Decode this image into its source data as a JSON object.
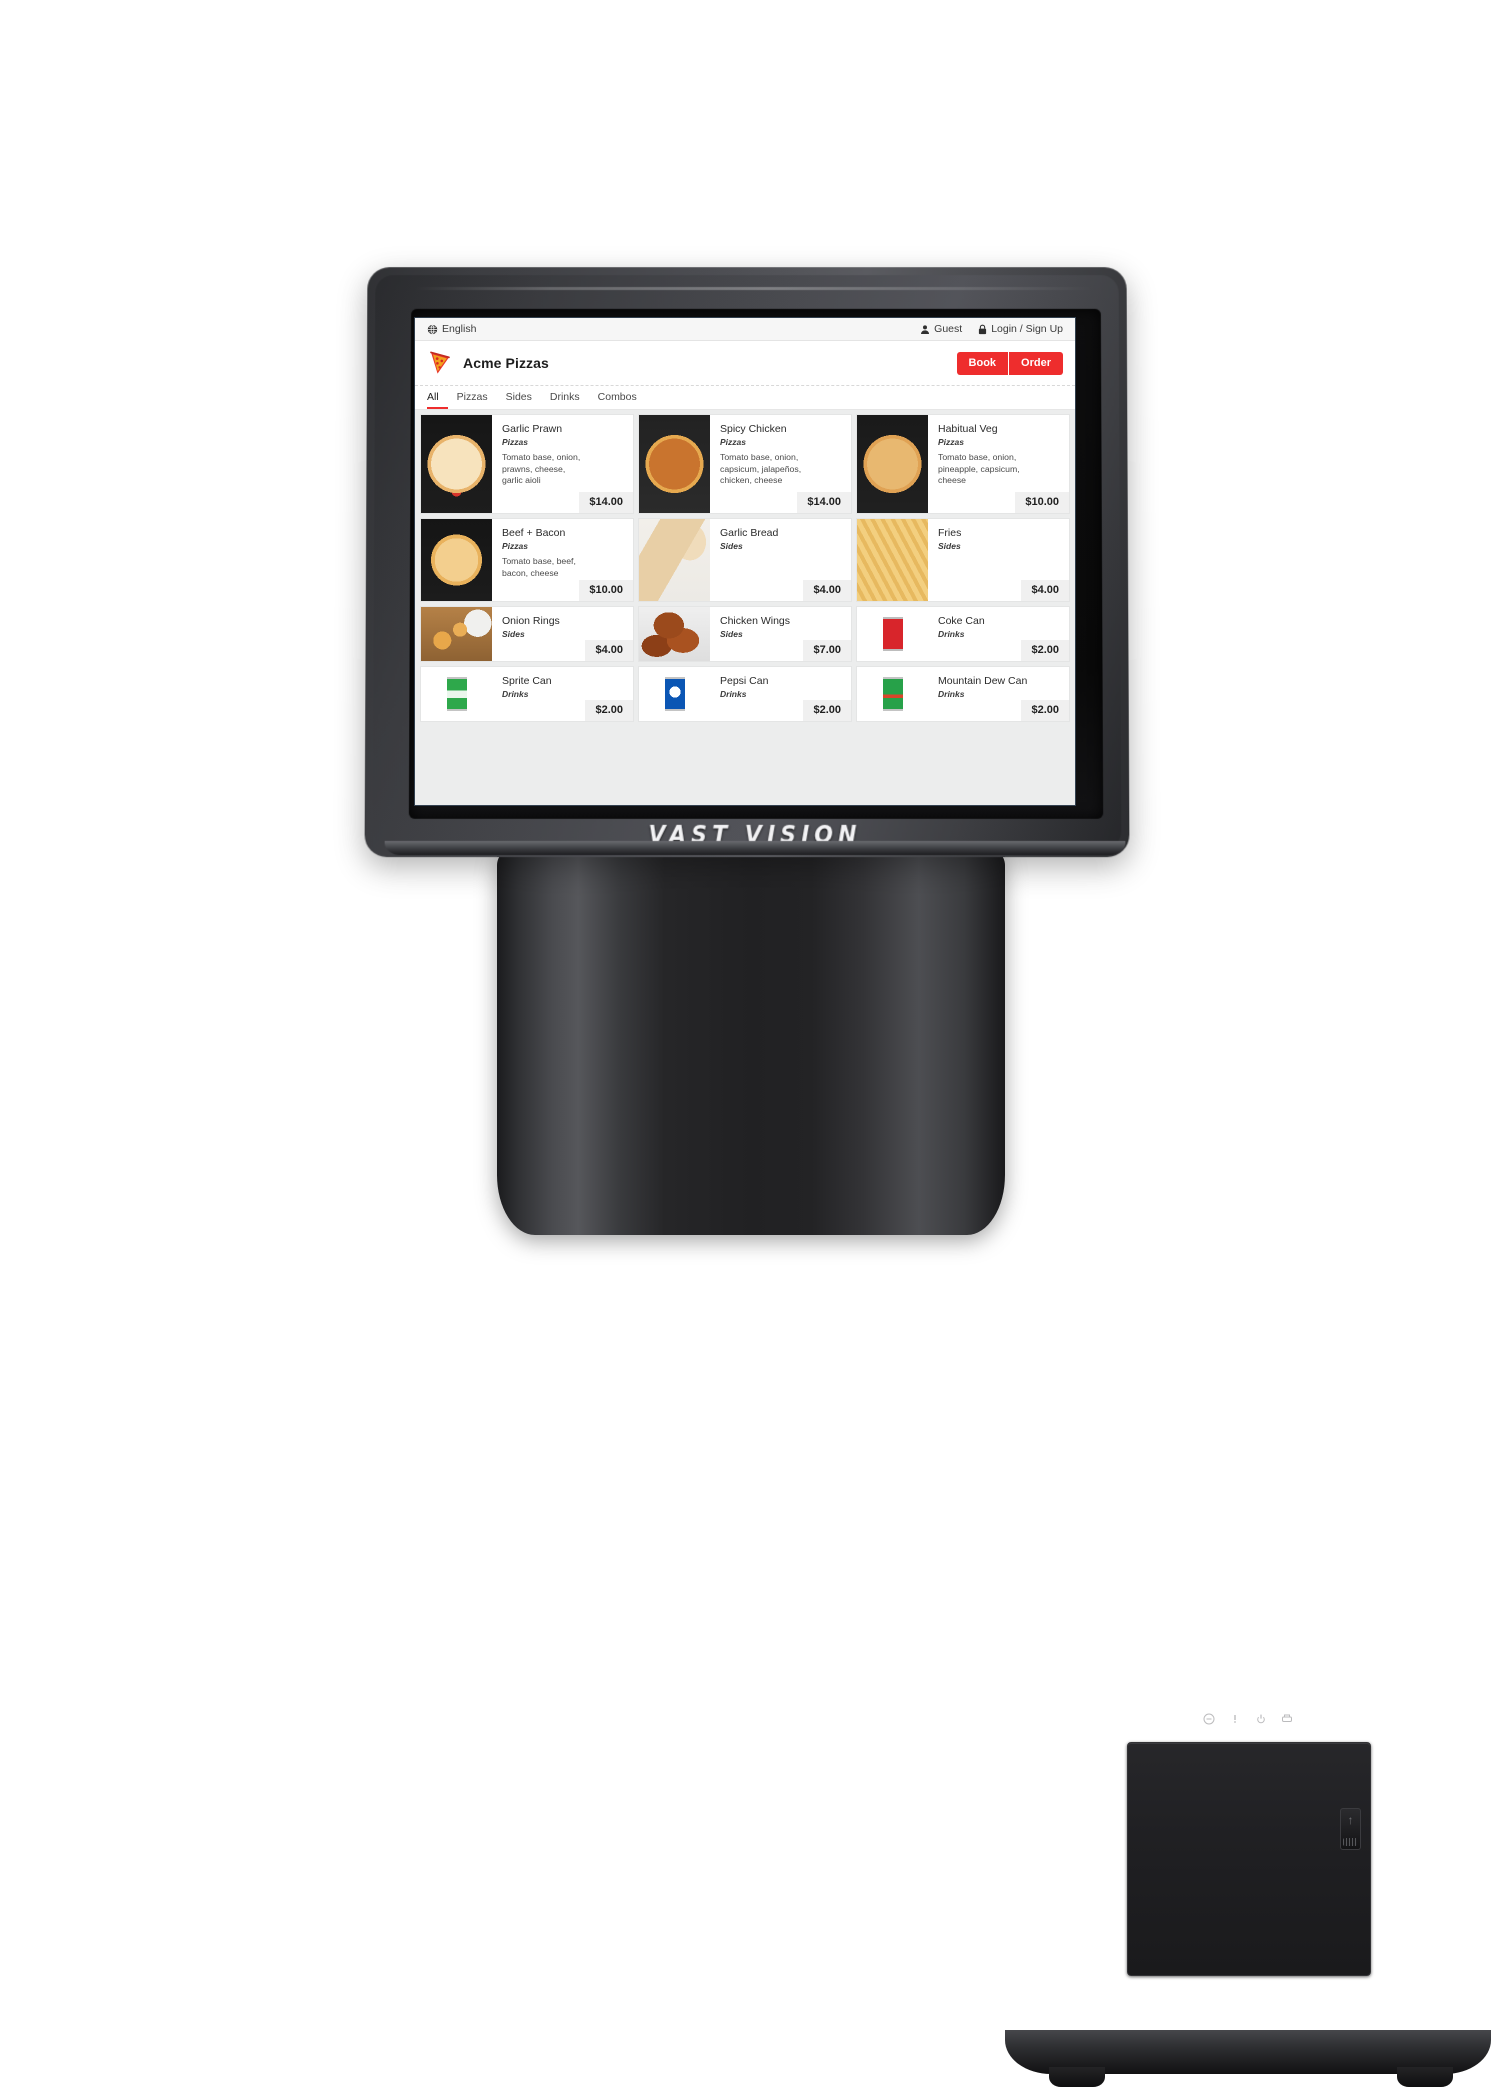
{
  "device": {
    "brand": "VAST VISION",
    "latch_arrow": "↑"
  },
  "screen": {
    "topbar": {
      "language_icon": "globe-icon",
      "language": "English",
      "guest_icon": "user-icon",
      "guest": "Guest",
      "login_icon": "lock-icon",
      "login": "Login / Sign Up"
    },
    "header": {
      "logo_icon": "pizza-slice-icon",
      "title": "Acme Pizzas",
      "book_label": "Book",
      "order_label": "Order",
      "accent_color": "#ee2d2d"
    },
    "tabs": [
      {
        "label": "All",
        "active": true
      },
      {
        "label": "Pizzas",
        "active": false
      },
      {
        "label": "Sides",
        "active": false
      },
      {
        "label": "Drinks",
        "active": false
      },
      {
        "label": "Combos",
        "active": false
      }
    ],
    "menu": {
      "rows": [
        {
          "items": [
            {
              "name": "Garlic Prawn",
              "category": "Pizzas",
              "description": "Tomato base, onion, prawns, cheese, garlic aioli",
              "price": "$14.00",
              "image": "pizza-garlic-prawn"
            },
            {
              "name": "Spicy Chicken",
              "category": "Pizzas",
              "description": "Tomato base, onion, capsicum, jalapeños, chicken, cheese",
              "price": "$14.00",
              "image": "pizza-spicy-chicken"
            },
            {
              "name": "Habitual Veg",
              "category": "Pizzas",
              "description": "Tomato base, onion, pineapple, capsicum, cheese",
              "price": "$10.00",
              "image": "pizza-habitual-veg"
            }
          ]
        },
        {
          "items": [
            {
              "name": "Beef + Bacon",
              "category": "Pizzas",
              "description": "Tomato base, beef, bacon, cheese",
              "price": "$10.00",
              "image": "pizza-beef-bacon"
            },
            {
              "name": "Garlic Bread",
              "category": "Sides",
              "description": "",
              "price": "$4.00",
              "image": "side-garlic-bread"
            },
            {
              "name": "Fries",
              "category": "Sides",
              "description": "",
              "price": "$4.00",
              "image": "side-fries"
            }
          ]
        },
        {
          "items": [
            {
              "name": "Onion Rings",
              "category": "Sides",
              "description": "",
              "price": "$4.00",
              "image": "side-onion-rings"
            },
            {
              "name": "Chicken Wings",
              "category": "Sides",
              "description": "",
              "price": "$7.00",
              "image": "side-chicken-wings"
            },
            {
              "name": "Coke Can",
              "category": "Drinks",
              "description": "",
              "price": "$2.00",
              "image": "drink-coke-can"
            }
          ]
        },
        {
          "items": [
            {
              "name": "Sprite Can",
              "category": "Drinks",
              "description": "",
              "price": "$2.00",
              "image": "drink-sprite-can"
            },
            {
              "name": "Pepsi Can",
              "category": "Drinks",
              "description": "",
              "price": "$2.00",
              "image": "drink-pepsi-can"
            },
            {
              "name": "Mountain Dew Can",
              "category": "Drinks",
              "description": "",
              "price": "$2.00",
              "image": "drink-mountain-dew-can"
            }
          ]
        }
      ]
    }
  }
}
